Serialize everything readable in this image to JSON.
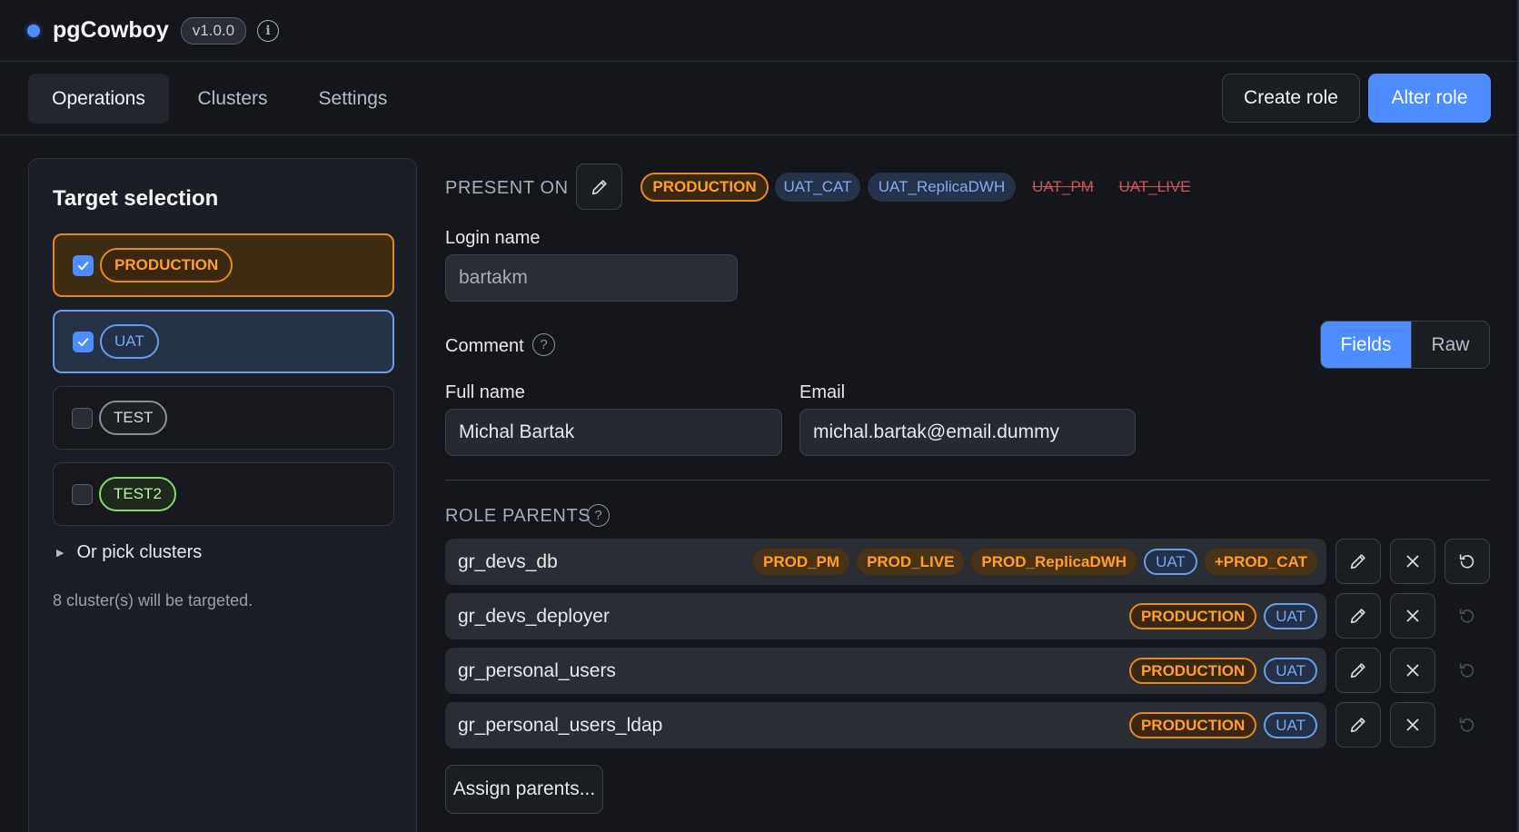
{
  "app": {
    "title": "pgCowboy",
    "version": "v1.0.0"
  },
  "nav": {
    "tabs": [
      {
        "label": "Operations",
        "active": true
      },
      {
        "label": "Clusters",
        "active": false
      },
      {
        "label": "Settings",
        "active": false
      }
    ],
    "create_role_label": "Create role",
    "alter_role_label": "Alter role"
  },
  "target_selection": {
    "title": "Target selection",
    "targets": [
      {
        "label": "PRODUCTION",
        "checked": true
      },
      {
        "label": "UAT",
        "checked": true
      },
      {
        "label": "TEST",
        "checked": false
      },
      {
        "label": "TEST2",
        "checked": false
      }
    ],
    "pick_clusters_label": "Or pick clusters",
    "targeted_info": "8 cluster(s) will be targeted."
  },
  "present_on": {
    "label": "PRESENT ON",
    "tags": [
      {
        "label": "PRODUCTION",
        "style": "prod-outline"
      },
      {
        "label": "UAT_CAT",
        "style": "uat-fill"
      },
      {
        "label": "UAT_ReplicaDWH",
        "style": "uat-fill"
      },
      {
        "label": "UAT_PM",
        "style": "strike"
      },
      {
        "label": "UAT_LIVE",
        "style": "strike"
      }
    ]
  },
  "form": {
    "login_name_label": "Login name",
    "login_name_value": "bartakm",
    "comment_label": "Comment",
    "mode_fields_label": "Fields",
    "mode_raw_label": "Raw",
    "full_name_label": "Full name",
    "full_name_value": "Michal Bartak",
    "email_label": "Email",
    "email_value": "michal.bartak@email.dummy"
  },
  "role_parents": {
    "label": "ROLE PARENTS",
    "rows": [
      {
        "name": "gr_devs_db",
        "tags": [
          "PROD_PM",
          "PROD_LIVE",
          "PROD_ReplicaDWH",
          "UAT",
          "+PROD_CAT"
        ]
      },
      {
        "name": "gr_devs_deployer",
        "tags": [
          "PRODUCTION",
          "UAT"
        ]
      },
      {
        "name": "gr_personal_users",
        "tags": [
          "PRODUCTION",
          "UAT"
        ]
      },
      {
        "name": "gr_personal_users_ldap",
        "tags": [
          "PRODUCTION",
          "UAT"
        ]
      }
    ],
    "assign_label": "Assign parents..."
  },
  "colors": {
    "accent": "#4d8dff",
    "production": "#ff9e2c",
    "uat": "#7aa7ee",
    "removed": "#c9545a"
  }
}
